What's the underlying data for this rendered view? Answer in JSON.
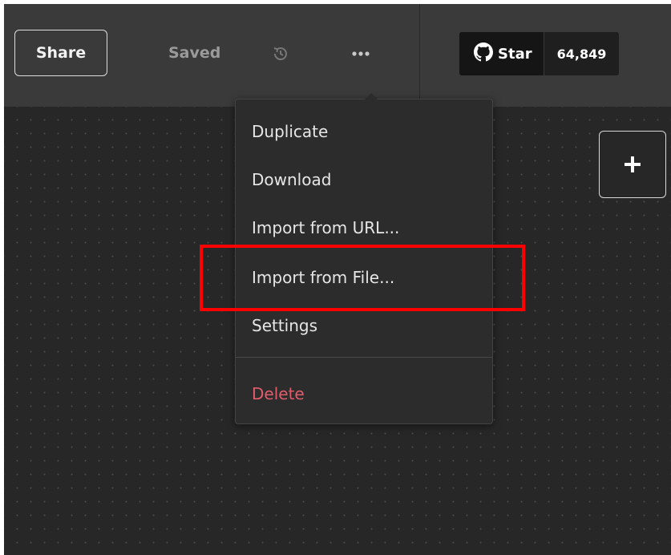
{
  "toolbar": {
    "share_label": "Share",
    "save_status": "Saved"
  },
  "github": {
    "star_label": "Star",
    "star_count": "64,849"
  },
  "menu": {
    "items": [
      {
        "label": "Duplicate"
      },
      {
        "label": "Download"
      },
      {
        "label": "Import from URL..."
      },
      {
        "label": "Import from File..."
      },
      {
        "label": "Settings"
      }
    ],
    "danger_item": {
      "label": "Delete",
      "color": "#e05c6b"
    }
  },
  "colors": {
    "background": "#272727",
    "toolbar": "#3a3a3a",
    "highlight": "#ff0000"
  },
  "icons": [
    "history-icon",
    "more-dots-icon",
    "github-icon",
    "plus-icon"
  ]
}
